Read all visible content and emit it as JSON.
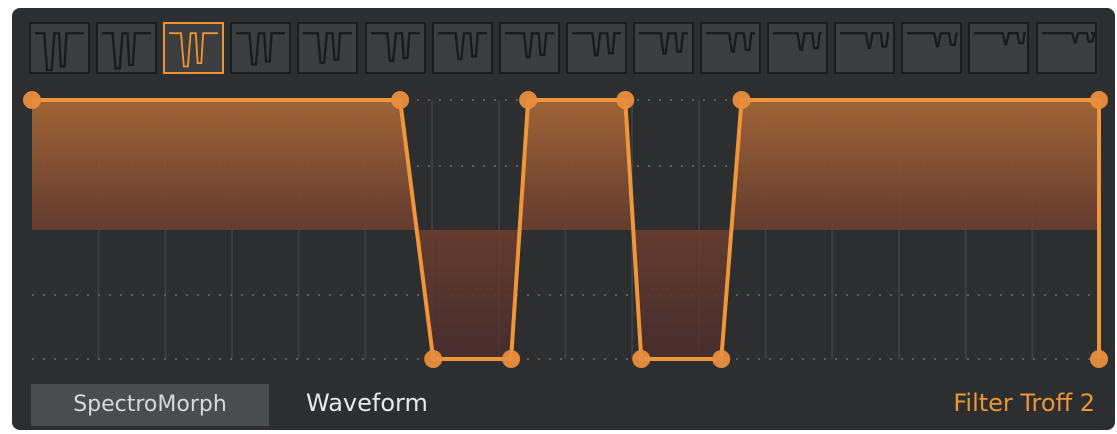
{
  "app": {
    "spectromorph_button": "SpectroMorph",
    "waveform_label": "Waveform",
    "preset_name": "Filter Troff 2"
  },
  "colors": {
    "accent": "#ee9434",
    "panel": "#2d2e30",
    "grid": "#3b3c3e"
  },
  "waveform_thumbnails": {
    "count": 16,
    "selected_index": 2
  },
  "waveform": {
    "points": [
      {
        "t": 0.0,
        "v": 1.0
      },
      {
        "t": 0.345,
        "v": 1.0
      },
      {
        "t": 0.376,
        "v": 0.0
      },
      {
        "t": 0.449,
        "v": 0.0
      },
      {
        "t": 0.465,
        "v": 1.0
      },
      {
        "t": 0.556,
        "v": 1.0
      },
      {
        "t": 0.571,
        "v": 0.0
      },
      {
        "t": 0.646,
        "v": 0.0
      },
      {
        "t": 0.665,
        "v": 1.0
      },
      {
        "t": 1.0,
        "v": 1.0
      },
      {
        "t": 1.0,
        "v": 0.0
      }
    ]
  }
}
